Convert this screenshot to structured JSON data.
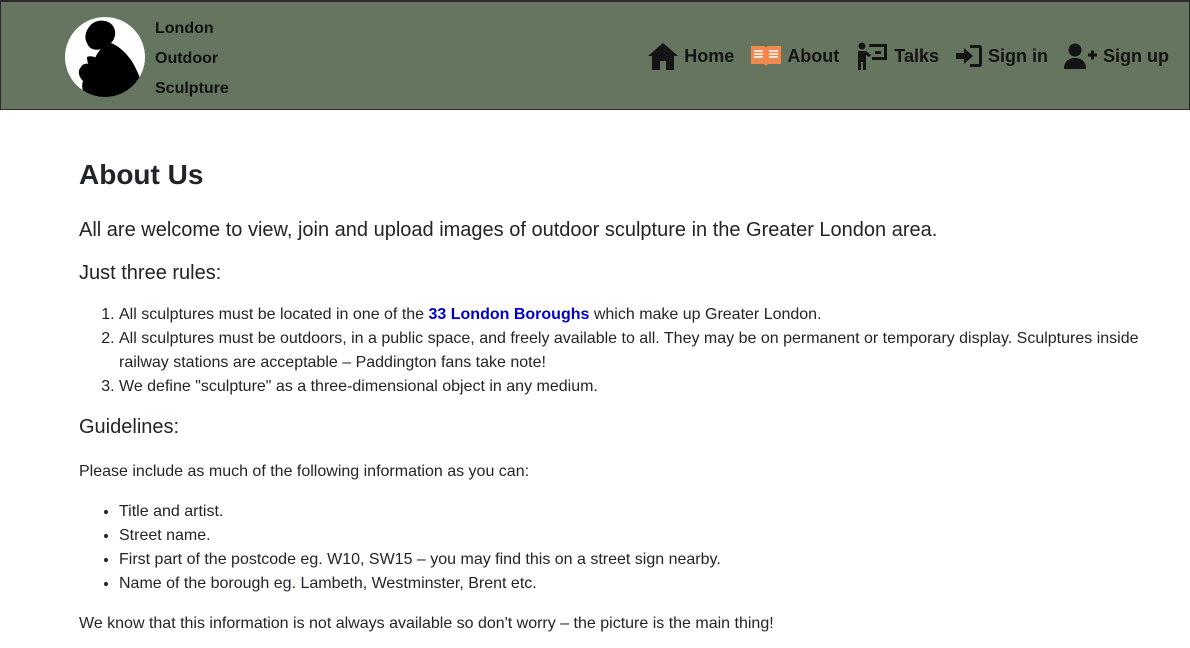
{
  "brand": {
    "line1": "London",
    "line2": "Outdoor",
    "line3": "Sculpture",
    "logo_icon": "thinker-silhouette-icon"
  },
  "nav": {
    "items": [
      {
        "label": "Home",
        "icon": "house-icon",
        "active": false
      },
      {
        "label": "About",
        "icon": "open-book-icon",
        "active": true
      },
      {
        "label": "Talks",
        "icon": "person-chalkboard-icon",
        "active": false
      },
      {
        "label": "Sign in",
        "icon": "sign-in-icon",
        "active": false
      },
      {
        "label": "Sign up",
        "icon": "user-plus-icon",
        "active": false
      }
    ],
    "active_icon_color": "#f4884c"
  },
  "page": {
    "title": "About Us",
    "lead": "All are welcome to view, join and upload images of outdoor sculpture in the Greater London area.",
    "rules_heading": "Just three rules:",
    "rules": [
      {
        "before": "All sculptures must be located in one of the ",
        "link": "33 London Boroughs",
        "after": " which make up Greater London."
      },
      {
        "text": "All sculptures must be outdoors, in a public space, and freely available to all. They may be on permanent or temporary display. Sculptures inside railway stations are acceptable – Paddington fans take note!"
      },
      {
        "text": "We define \"sculpture\" as a three-dimensional object in any medium."
      }
    ],
    "guidelines_heading": "Guidelines:",
    "guidelines_intro": "Please include as much of the following information as you can:",
    "guidelines": [
      "Title and artist.",
      "Street name.",
      "First part of the postcode eg. W10, SW15 – you may find this on a street sign nearby.",
      "Name of the borough eg. Lambeth, Westminster, Brent etc."
    ],
    "closing": "We know that this information is not always available so don't worry – the picture is the main thing!"
  },
  "colors": {
    "navbar_bg": "#66755f",
    "link": "#0000cc"
  }
}
